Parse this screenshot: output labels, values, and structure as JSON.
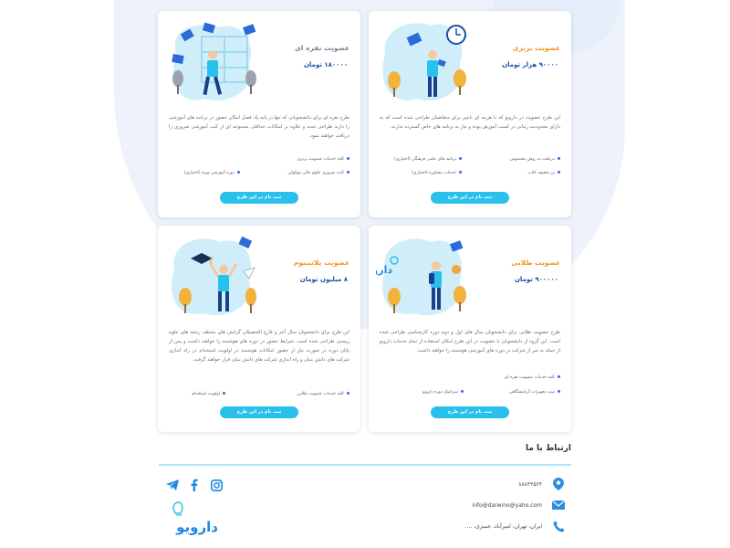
{
  "plans": [
    {
      "title": "عضویت برنزی",
      "price": "۹۰۰۰۰   هزار تومان",
      "desc": "این طرح عضویت در دارویو که با هزینه ای ناچیز برای متقاضیان طراحی شده است که به دارای محدودیت زمانی در کسب آموزش بوده و نیاز به برنامه های خاص گسترده ندارند.",
      "features": [
        "دریافت به روش مخصوص",
        "برنامه های علمی فرهنگی (اختیاری)",
        "بن تخفیف کتاب",
        "خدمات مشاوره (اختیاری)"
      ],
      "button": "ثبت نام در این طرح"
    },
    {
      "title": "عضویت نقره ای",
      "price": "۱۸۰۰۰۰ تومان",
      "desc": "طرح نقره ای برای دانشجویانی که تنها در پایه یک فصل امکان حضور در برنامه های آموزشی را دارند طراحی شده و علاوه بر امکانات حداقلی مجموعه ای از کتب آموزشی ضروری را دریافت خواهند نمود.",
      "features": [
        "کلیه خدمات عضویت برنزی",
        "کتب ضروری علوم مالی موکولی",
        "دوره آموزشی ویژه (اختیاری)"
      ],
      "button": "ثبت نام در این طرح"
    },
    {
      "title": "عضویت طلایی",
      "price": "۹۰۰۰۰۰ تومان",
      "desc": "طرح عضویت طلایی برای دانشجویان سال های اول و دوم دوره کارشناسی طراحی شده است. این گروه از دانشجویان با عضویت در این طرح امکان استفاده از تمام خدمات دارویو از جمله به غیر از شرکت در دوره های آموزشی هوشمند را خواهند داشت.",
      "features": [
        "کلیه خدمات عضویت نقره ای",
        "ست تجهیزات آزمایشگاهی",
        "سرامیک دوره دارویو"
      ],
      "button": "ثبت نام در این طرح"
    },
    {
      "title": "عضویت پلاتینیوم",
      "price": "۸ میلیون تومان",
      "desc": "این طرح برای دانشجویان سال آخر و فارغ التحصیلان گرایش های مختلف رشته های علوم زیستی طراحی شده است. شرایط حضور در دوره های هوشمند را خواهند داشت و پس از پایان دوره در صورت نیاز از حضور امکانات هوشمند در اولویت استخدام در راه اندازی شرکت های دانش بنیان و راه اندازی شرکت های دانش بنیان قرار خواهند گرفت.",
      "features": [
        "کلیه خدمات عضویت طلایی",
        "اولویت استخدام"
      ],
      "button": "ثبت نام در این طرح"
    }
  ],
  "contact": {
    "title": "ارتباط با ما",
    "phone": "۸۸۸۴۳۵۶۴",
    "email": "info@darwino@yaho.com",
    "address": "ایران، تهران، امیرآباد، جمبزی، ....",
    "brand": "دارویو"
  },
  "colors": {
    "accent": "#29c1ec",
    "title_orange": "#f2951c",
    "price_blue": "#1a4fa8",
    "icon_blue": "#2a8ee0"
  },
  "icons": [
    "location-icon",
    "email-icon",
    "phone-icon",
    "telegram-icon",
    "facebook-icon",
    "instagram-icon"
  ]
}
